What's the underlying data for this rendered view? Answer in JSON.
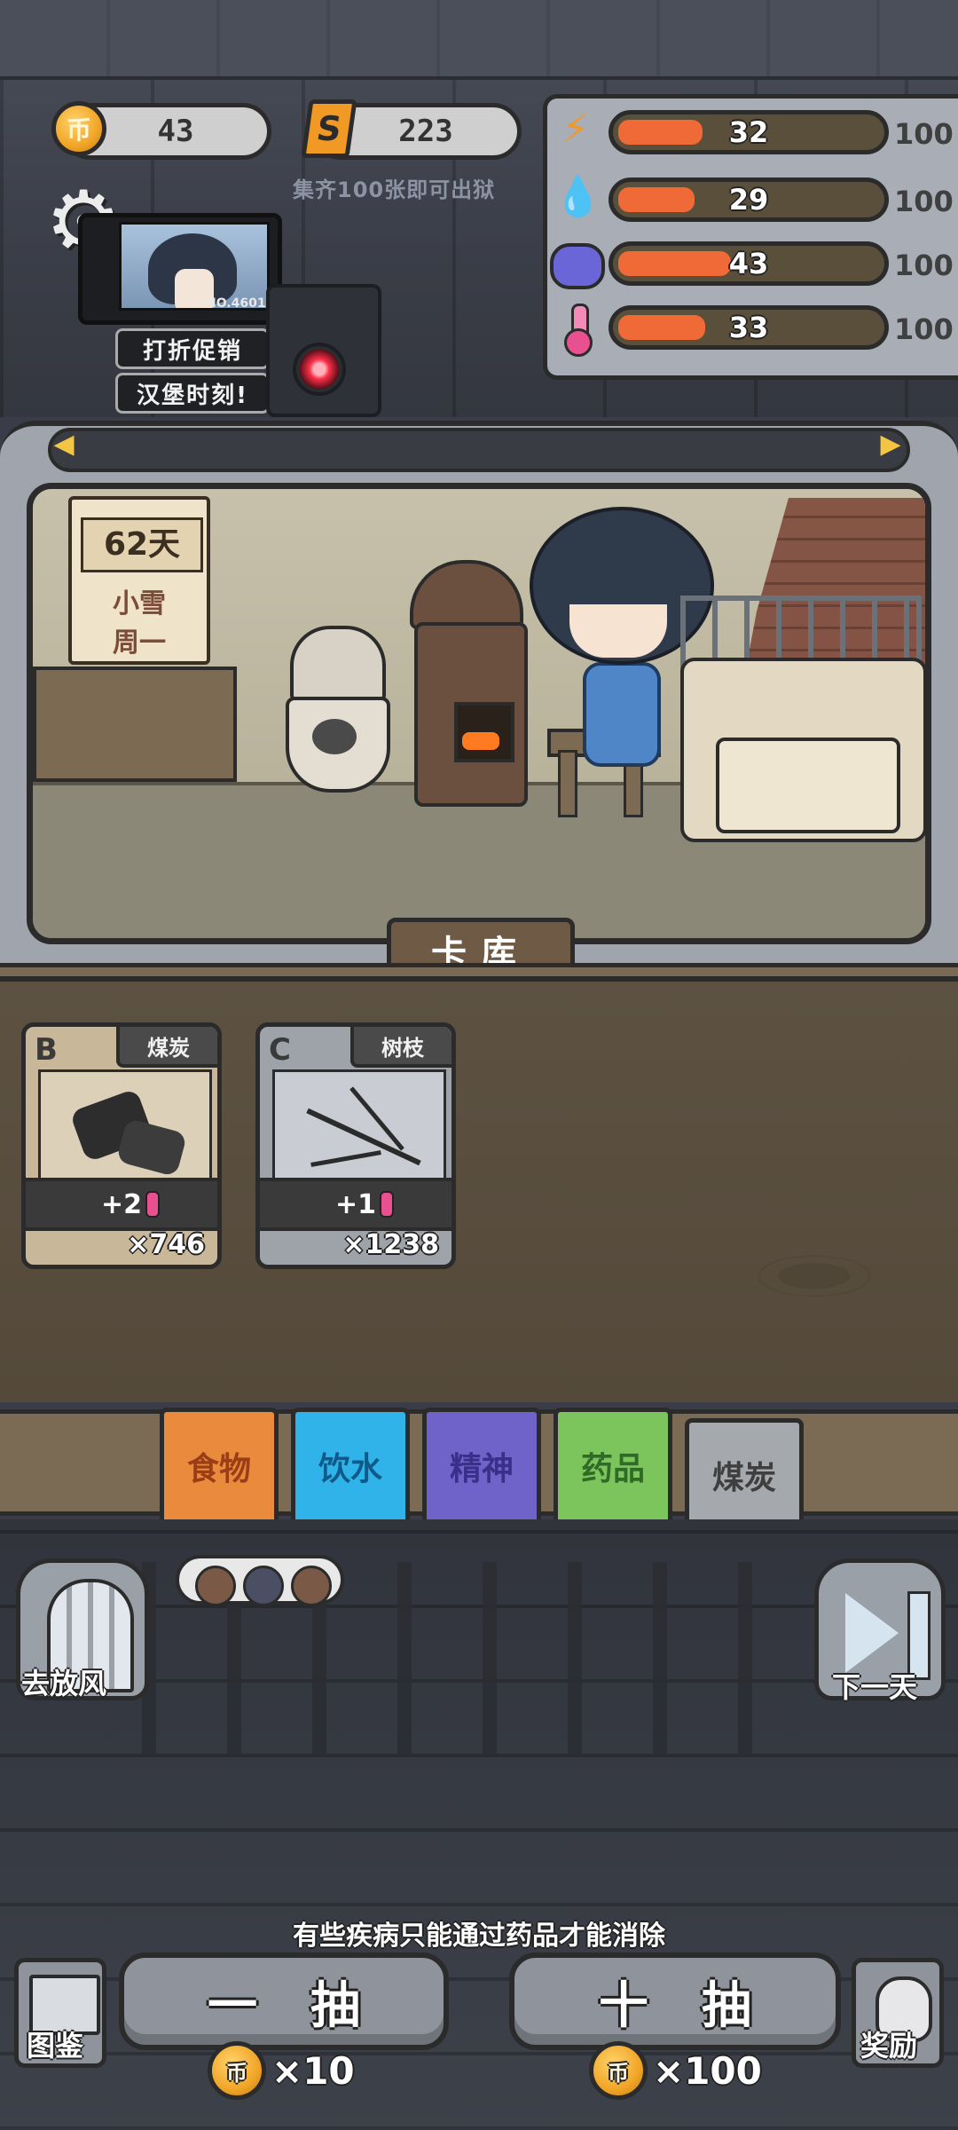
{
  "currencies": {
    "coin": {
      "icon_label": "币",
      "value": "43"
    },
    "shard": {
      "icon_label": "S",
      "value": "223"
    }
  },
  "collect_hint": "集齐100张即可出狱",
  "monitor": {
    "id_label": "NO.4601"
  },
  "promos": [
    "打折促销",
    "汉堡时刻!"
  ],
  "stats": [
    {
      "name": "energy",
      "icon": "lightning-icon",
      "value": "32",
      "max": "100",
      "fraction": 0.32
    },
    {
      "name": "water",
      "icon": "water-drop-icon",
      "value": "29",
      "max": "100",
      "fraction": 0.29
    },
    {
      "name": "mind",
      "icon": "brain-icon",
      "value": "43",
      "max": "100",
      "fraction": 0.43
    },
    {
      "name": "temperature",
      "icon": "thermometer-icon",
      "value": "33",
      "max": "100",
      "fraction": 0.33
    }
  ],
  "calendar": {
    "day": "62天",
    "weather": "小雪",
    "weekday": "周一"
  },
  "section_tab": "卡库",
  "cards": [
    {
      "grade": "B",
      "name": "煤炭",
      "effect": "+2",
      "count": "×746"
    },
    {
      "grade": "C",
      "name": "树枝",
      "effect": "+1",
      "count": "×1238"
    }
  ],
  "categories": [
    "食物",
    "饮水",
    "精神",
    "药品",
    "煤炭"
  ],
  "selected_category": "煤炭",
  "side_buttons": {
    "yard": "去放风",
    "next_day": "下一天"
  },
  "tip": "有些疾病只能通过药品才能消除",
  "draw": {
    "single": {
      "label": "一抽",
      "cost": "×10"
    },
    "ten": {
      "label": "十抽",
      "cost": "×100"
    }
  },
  "corner_buttons": {
    "codex": "图鉴",
    "reward": "奖励"
  },
  "colors": {
    "accent_orange": "#ef6a36",
    "coin_gold": "#f1a527",
    "frame_dark": "#2b2b2b"
  }
}
